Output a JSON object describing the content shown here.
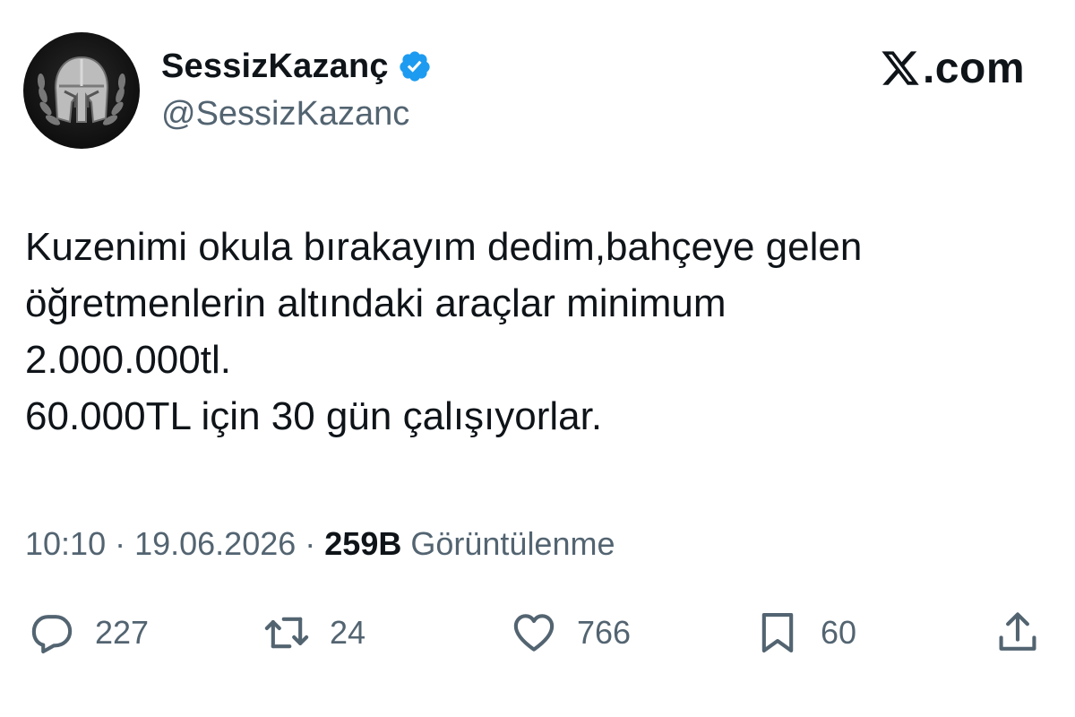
{
  "author": {
    "display_name": "SessizKazanç",
    "handle": "@SessizKazanc",
    "verified": true
  },
  "brand": {
    "text": ".com",
    "icon": "x-logo-icon"
  },
  "tweet": {
    "lines": [
      "Kuzenimi okula bırakayım dedim,bahçeye gelen",
      "öğretmenlerin altındaki araçlar minimum",
      "2.000.000tl.",
      "60.000TL için 30 gün çalışıyorlar."
    ]
  },
  "meta": {
    "time": "10:10",
    "separator": " · ",
    "date": "19.06.2026",
    "views_count": "259B",
    "views_label": "Görüntülenme"
  },
  "actions": {
    "replies": "227",
    "reposts": "24",
    "likes": "766",
    "bookmarks": "60"
  },
  "colors": {
    "text": "#0f1419",
    "secondary": "#536471",
    "verified_blue": "#1d9bf0",
    "background": "#ffffff"
  }
}
